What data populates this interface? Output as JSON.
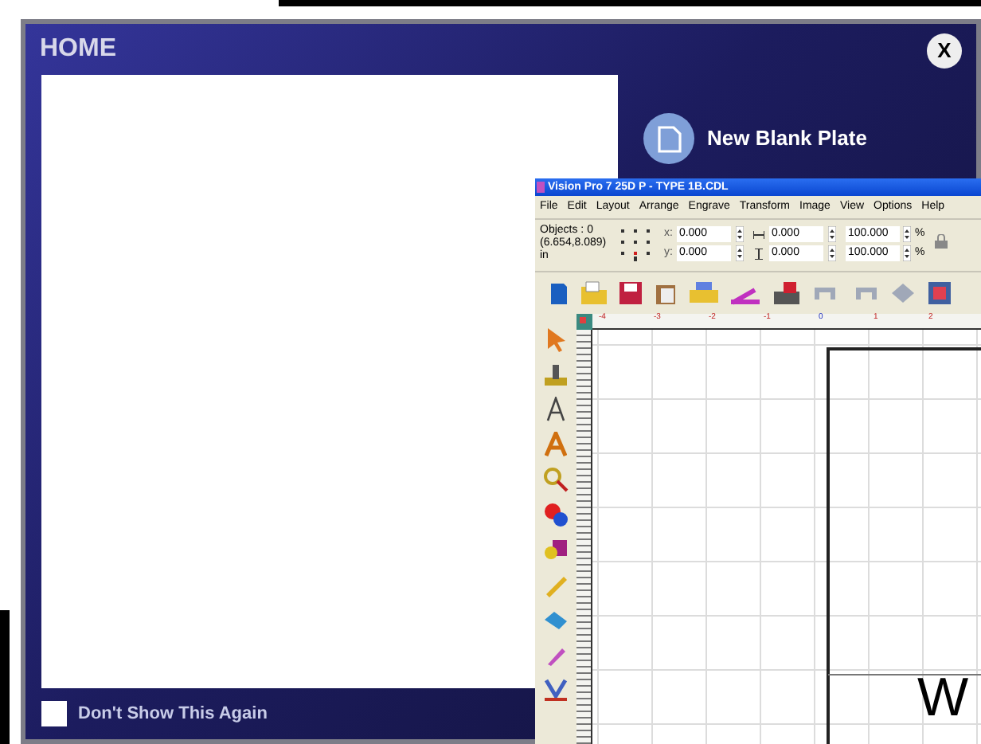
{
  "home_dialog": {
    "title": "HOME",
    "close_label": "X",
    "new_plate_label": "New Blank Plate",
    "dont_show": {
      "label": "Don't Show This Again",
      "checked": false
    }
  },
  "vision_window": {
    "title": "Vision Pro 7 25D P - TYPE 1B.CDL",
    "menu": [
      "File",
      "Edit",
      "Layout",
      "Arrange",
      "Engrave",
      "Transform",
      "Image",
      "View",
      "Options",
      "Help"
    ],
    "objects": "Objects : 0",
    "coords": "(6.654,8.089)",
    "units": "in",
    "position_fields": [
      {
        "label": "x:",
        "value": "0.000"
      },
      {
        "label": "y:",
        "value": "0.000"
      }
    ],
    "size_fields": [
      "0.000",
      "0.000"
    ],
    "scale_fields": [
      {
        "value": "100.000",
        "unit": "%"
      },
      {
        "value": "100.000",
        "unit": "%"
      }
    ],
    "ruler_labels": [
      "-4",
      "-3",
      "-2",
      "-1",
      "0",
      "1",
      "2"
    ],
    "canvas_text": "W"
  }
}
